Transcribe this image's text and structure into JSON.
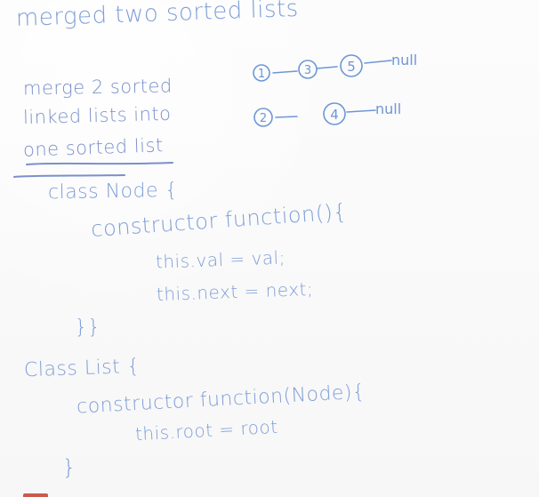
{
  "title": "merged two sorted lists",
  "description": [
    "merge 2 sorted",
    "linked lists into",
    "one sorted list"
  ],
  "diagram": {
    "list1": [
      "1",
      "3",
      "5",
      "null"
    ],
    "list2": [
      "2",
      "4",
      "null"
    ]
  },
  "code_lines": [
    "class Node {",
    "constructor function(){",
    "this.val = val;",
    "this.next = next;",
    "}}",
    "Class List {",
    "constructor function(Node){",
    "this.root = root",
    "}"
  ],
  "colors": {
    "ink": "#6e97d6",
    "paper": "#fbfbfb",
    "bottom_mark": "#c95a4d"
  }
}
